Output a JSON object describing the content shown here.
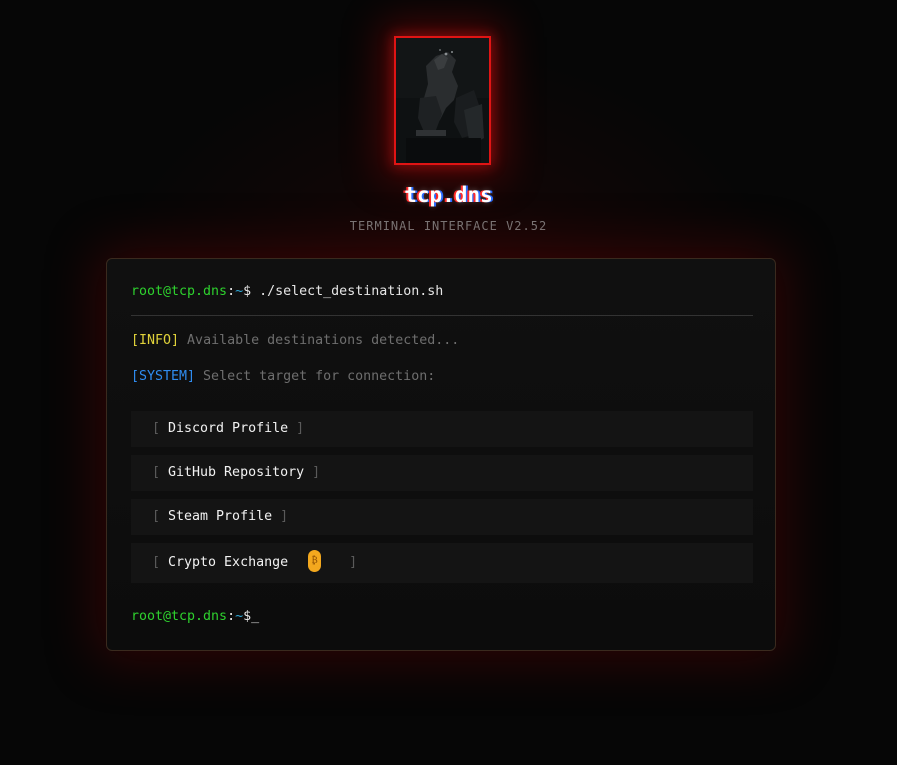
{
  "header": {
    "title": "tcp.dns",
    "subtitle": "TERMINAL INTERFACE V2.52"
  },
  "terminal": {
    "prompt": {
      "user_host": "root@tcp.dns",
      "separator": ":",
      "path": "~",
      "symbol": "$",
      "command": " ./select_destination.sh"
    },
    "info": {
      "tag": "[INFO]",
      "text": " Available destinations detected..."
    },
    "system": {
      "tag": "[SYSTEM]",
      "text": " Select target for connection:"
    },
    "destinations": [
      {
        "label": "Discord Profile",
        "icon": null
      },
      {
        "label": "GitHub Repository",
        "icon": null
      },
      {
        "label": "Steam Profile",
        "icon": null
      },
      {
        "label": "Crypto Exchange",
        "icon": "bitcoin-icon"
      }
    ],
    "bracket_open": "[ ",
    "bracket_close": " ]",
    "final_prompt": {
      "user_host": "root@tcp.dns",
      "separator": ":",
      "path": "~",
      "symbol": "$",
      "cursor": "_"
    }
  },
  "colors": {
    "accent_red": "#e01414",
    "prompt_green": "#2ed12e",
    "path_cyan": "#2fa9d8",
    "info_yellow": "#e0d23a",
    "system_blue": "#2f8cf0",
    "bitcoin_orange": "#f3a81e"
  }
}
